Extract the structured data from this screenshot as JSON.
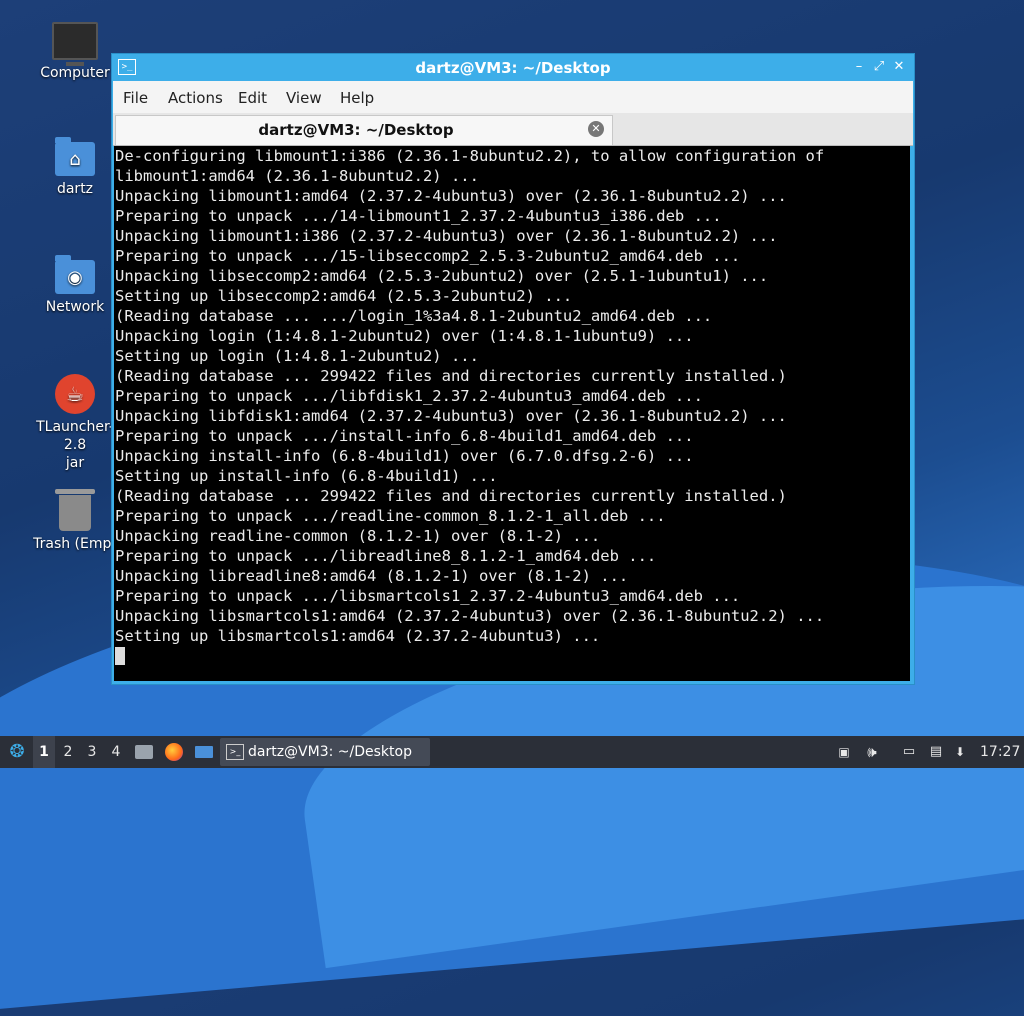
{
  "desktop": {
    "icons": [
      {
        "label": "Computer",
        "icon": "computer-icon"
      },
      {
        "label": "dartz",
        "icon": "home-folder-icon"
      },
      {
        "label": "Network",
        "icon": "network-folder-icon"
      },
      {
        "label": "TLauncher-2.8",
        "label2": "jar",
        "icon": "java-jar-icon"
      },
      {
        "label": "Trash (Empt",
        "icon": "trash-icon"
      }
    ]
  },
  "window": {
    "title": "dartz@VM3: ~/Desktop",
    "controls": {
      "minimize": "–",
      "maximize": "⤢",
      "close": "✕"
    },
    "menu": [
      "File",
      "Actions",
      "Edit",
      "View",
      "Help"
    ],
    "tab": {
      "title": "dartz@VM3: ~/Desktop",
      "close": "✕"
    }
  },
  "terminal": {
    "lines": [
      "De-configuring libmount1:i386 (2.36.1-8ubuntu2.2), to allow configuration of",
      "libmount1:amd64 (2.36.1-8ubuntu2.2) ...",
      "Unpacking libmount1:amd64 (2.37.2-4ubuntu3) over (2.36.1-8ubuntu2.2) ...",
      "Preparing to unpack .../14-libmount1_2.37.2-4ubuntu3_i386.deb ...",
      "Unpacking libmount1:i386 (2.37.2-4ubuntu3) over (2.36.1-8ubuntu2.2) ...",
      "Preparing to unpack .../15-libseccomp2_2.5.3-2ubuntu2_amd64.deb ...",
      "Unpacking libseccomp2:amd64 (2.5.3-2ubuntu2) over (2.5.1-1ubuntu1) ...",
      "Setting up libseccomp2:amd64 (2.5.3-2ubuntu2) ...",
      "(Reading database ... .../login_1%3a4.8.1-2ubuntu2_amd64.deb ...",
      "Unpacking login (1:4.8.1-2ubuntu2) over (1:4.8.1-1ubuntu9) ...",
      "Setting up login (1:4.8.1-2ubuntu2) ...",
      "(Reading database ... 299422 files and directories currently installed.)",
      "Preparing to unpack .../libfdisk1_2.37.2-4ubuntu3_amd64.deb ...",
      "Unpacking libfdisk1:amd64 (2.37.2-4ubuntu3) over (2.36.1-8ubuntu2.2) ...",
      "Preparing to unpack .../install-info_6.8-4build1_amd64.deb ...",
      "Unpacking install-info (6.8-4build1) over (6.7.0.dfsg.2-6) ...",
      "Setting up install-info (6.8-4build1) ...",
      "(Reading database ... 299422 files and directories currently installed.)",
      "Preparing to unpack .../readline-common_8.1.2-1_all.deb ...",
      "Unpacking readline-common (8.1.2-1) over (8.1-2) ...",
      "Preparing to unpack .../libreadline8_8.1.2-1_amd64.deb ...",
      "Unpacking libreadline8:amd64 (8.1.2-1) over (8.1-2) ...",
      "Preparing to unpack .../libsmartcols1_2.37.2-4ubuntu3_amd64.deb ...",
      "Unpacking libsmartcols1:amd64 (2.37.2-4ubuntu3) over (2.36.1-8ubuntu2.2) ...",
      "Setting up libsmartcols1:amd64 (2.37.2-4ubuntu3) ..."
    ]
  },
  "taskbar": {
    "workspaces": [
      "1",
      "2",
      "3",
      "4"
    ],
    "active_workspace": "1",
    "task_label": "dartz@VM3: ~/Desktop",
    "clock": "17:27",
    "colors": {
      "bar": "#2b2f38",
      "accent": "#3daee9"
    }
  }
}
